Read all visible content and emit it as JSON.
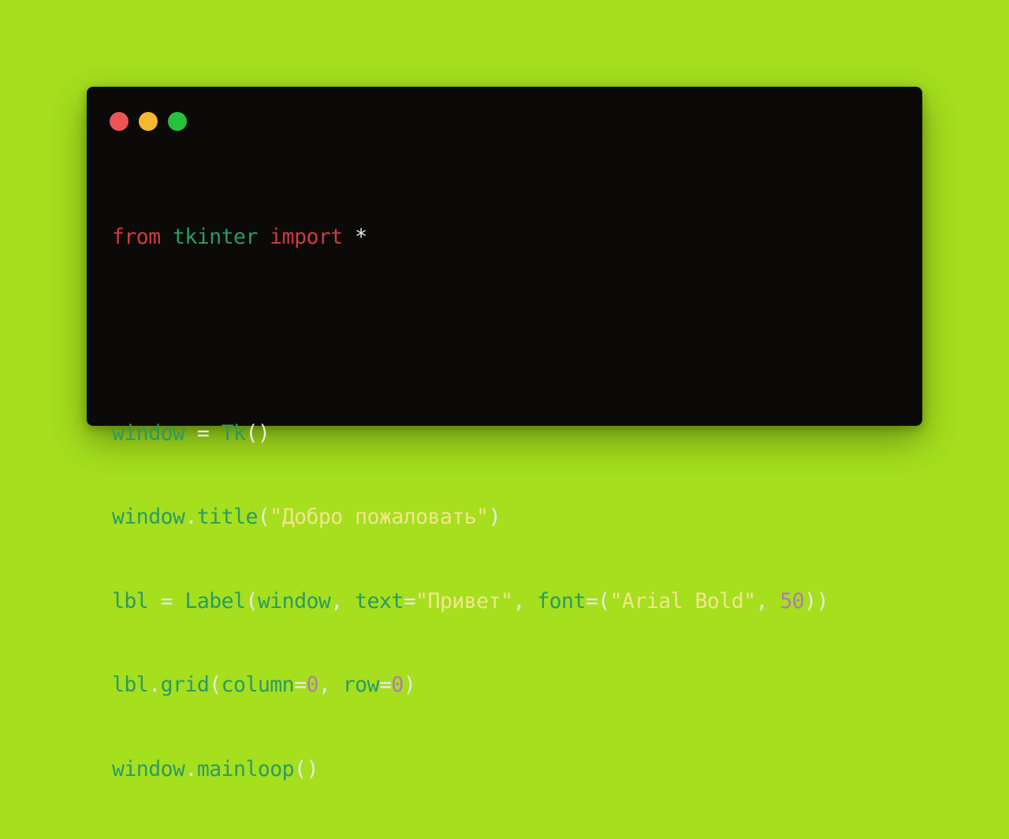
{
  "colors": {
    "background": "#a5df1e",
    "window_background": "#0b0a09",
    "close_dot": "#ed5456",
    "minimize_dot": "#f3b731",
    "zoom_dot": "#27c13f",
    "keyword": "#d13b3b",
    "identifier": "#2b9b63",
    "string": "#f4e58f",
    "number": "#b07bb2",
    "punctuation": "#e8e8e8"
  },
  "window_controls": [
    {
      "name": "close-dot",
      "icon": "red-circle"
    },
    {
      "name": "minimize-dot",
      "icon": "yellow-circle"
    },
    {
      "name": "zoom-dot",
      "icon": "green-circle"
    }
  ],
  "code": {
    "line1": {
      "from": "from",
      "module": "tkinter",
      "import": "import",
      "star": "*"
    },
    "line2": {
      "var": "window",
      "eq": "=",
      "call": "Tk",
      "parens": "()"
    },
    "line3": {
      "obj": "window",
      "dot": ".",
      "method": "title",
      "open": "(",
      "arg": "\"Добро пожаловать\"",
      "close": ")"
    },
    "line4": {
      "var": "lbl",
      "eq": "=",
      "call": "Label",
      "open": "(",
      "arg1": "window",
      "comma1": ",",
      "kw1": "text",
      "eq1": "=",
      "str1": "\"Привет\"",
      "comma2": ",",
      "kw2": "font",
      "eq2": "=(",
      "str2": "\"Arial Bold\"",
      "comma3": ",",
      "num": "50",
      "close": "))"
    },
    "line5": {
      "obj": "lbl",
      "dot": ".",
      "method": "grid",
      "open": "(",
      "kw1": "column",
      "eq1": "=",
      "num1": "0",
      "comma": ",",
      "kw2": "row",
      "eq2": "=",
      "num2": "0",
      "close": ")"
    },
    "line6": {
      "obj": "window",
      "dot": ".",
      "method": "mainloop",
      "parens": "()"
    }
  }
}
